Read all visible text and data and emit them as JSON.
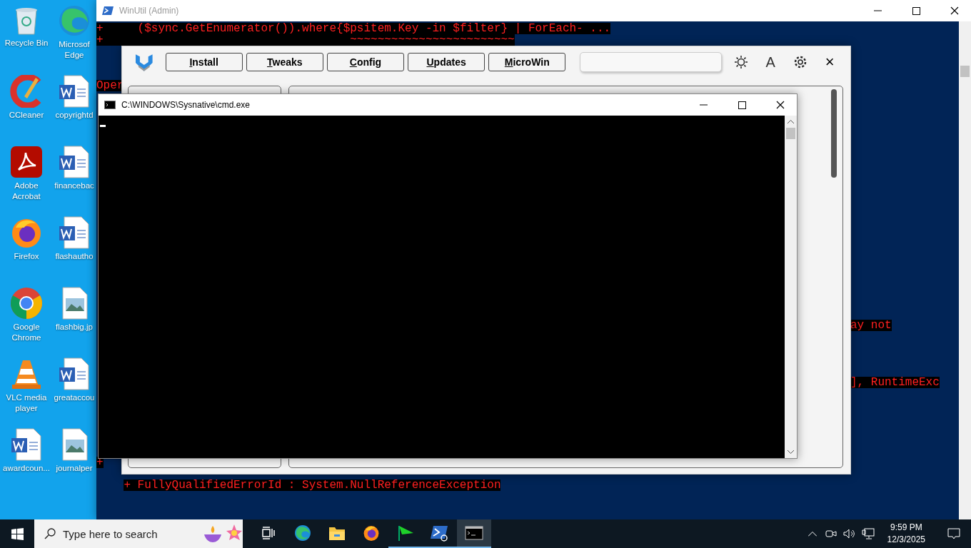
{
  "desktop": {
    "icons": [
      {
        "kind": "recycle",
        "label": "Recycle Bin"
      },
      {
        "kind": "edge",
        "label": "Microsof Edge"
      },
      {
        "kind": "ccleaner",
        "label": "CCleaner"
      },
      {
        "kind": "word",
        "label": "copyrightd"
      },
      {
        "kind": "acrobat",
        "label": "Adobe Acrobat"
      },
      {
        "kind": "word",
        "label": "financebac"
      },
      {
        "kind": "firefox",
        "label": "Firefox"
      },
      {
        "kind": "word",
        "label": "flashautho"
      },
      {
        "kind": "chrome",
        "label": "Google Chrome"
      },
      {
        "kind": "image",
        "label": "flashbig.jp"
      },
      {
        "kind": "vlc",
        "label": "VLC media player"
      },
      {
        "kind": "word",
        "label": "greataccou"
      },
      {
        "kind": "word",
        "label": "awardcoun..."
      },
      {
        "kind": "image",
        "label": "journalper"
      }
    ]
  },
  "powershell_window": {
    "title": "WinUtil (Admin)",
    "lines": [
      "+     ($sync.GetEnumerator()).where{$psitem.Key -in $filter} | ForEach- ...",
      "+                                    ~~~~~~~~~~~~~~~~~~~~~~~~",
      "Oper",
      "ay not",
      "], RuntimeExc",
      "+",
      "+ FullyQualifiedErrorId : System.NullReferenceException"
    ]
  },
  "winutil_window": {
    "tabs": [
      {
        "label": "Install"
      },
      {
        "label": "Tweaks"
      },
      {
        "label": "Config"
      },
      {
        "label": "Updates"
      },
      {
        "label": "MicroWin"
      }
    ],
    "font_button": "A",
    "close": "×"
  },
  "cmd_window": {
    "title": "C:\\WINDOWS\\Sysnative\\cmd.exe"
  },
  "taskbar": {
    "search_placeholder": "Type here to search",
    "apps": [
      {
        "kind": "taskview",
        "running": false,
        "selected": false
      },
      {
        "kind": "edge",
        "running": false,
        "selected": false
      },
      {
        "kind": "explorer",
        "running": false,
        "selected": false
      },
      {
        "kind": "firefox",
        "running": false,
        "selected": false
      },
      {
        "kind": "flag",
        "running": true,
        "selected": false
      },
      {
        "kind": "powershell",
        "running": true,
        "selected": false
      },
      {
        "kind": "cmd",
        "running": true,
        "selected": true
      }
    ],
    "time": "9:59 PM",
    "date": "12/3/2025"
  }
}
